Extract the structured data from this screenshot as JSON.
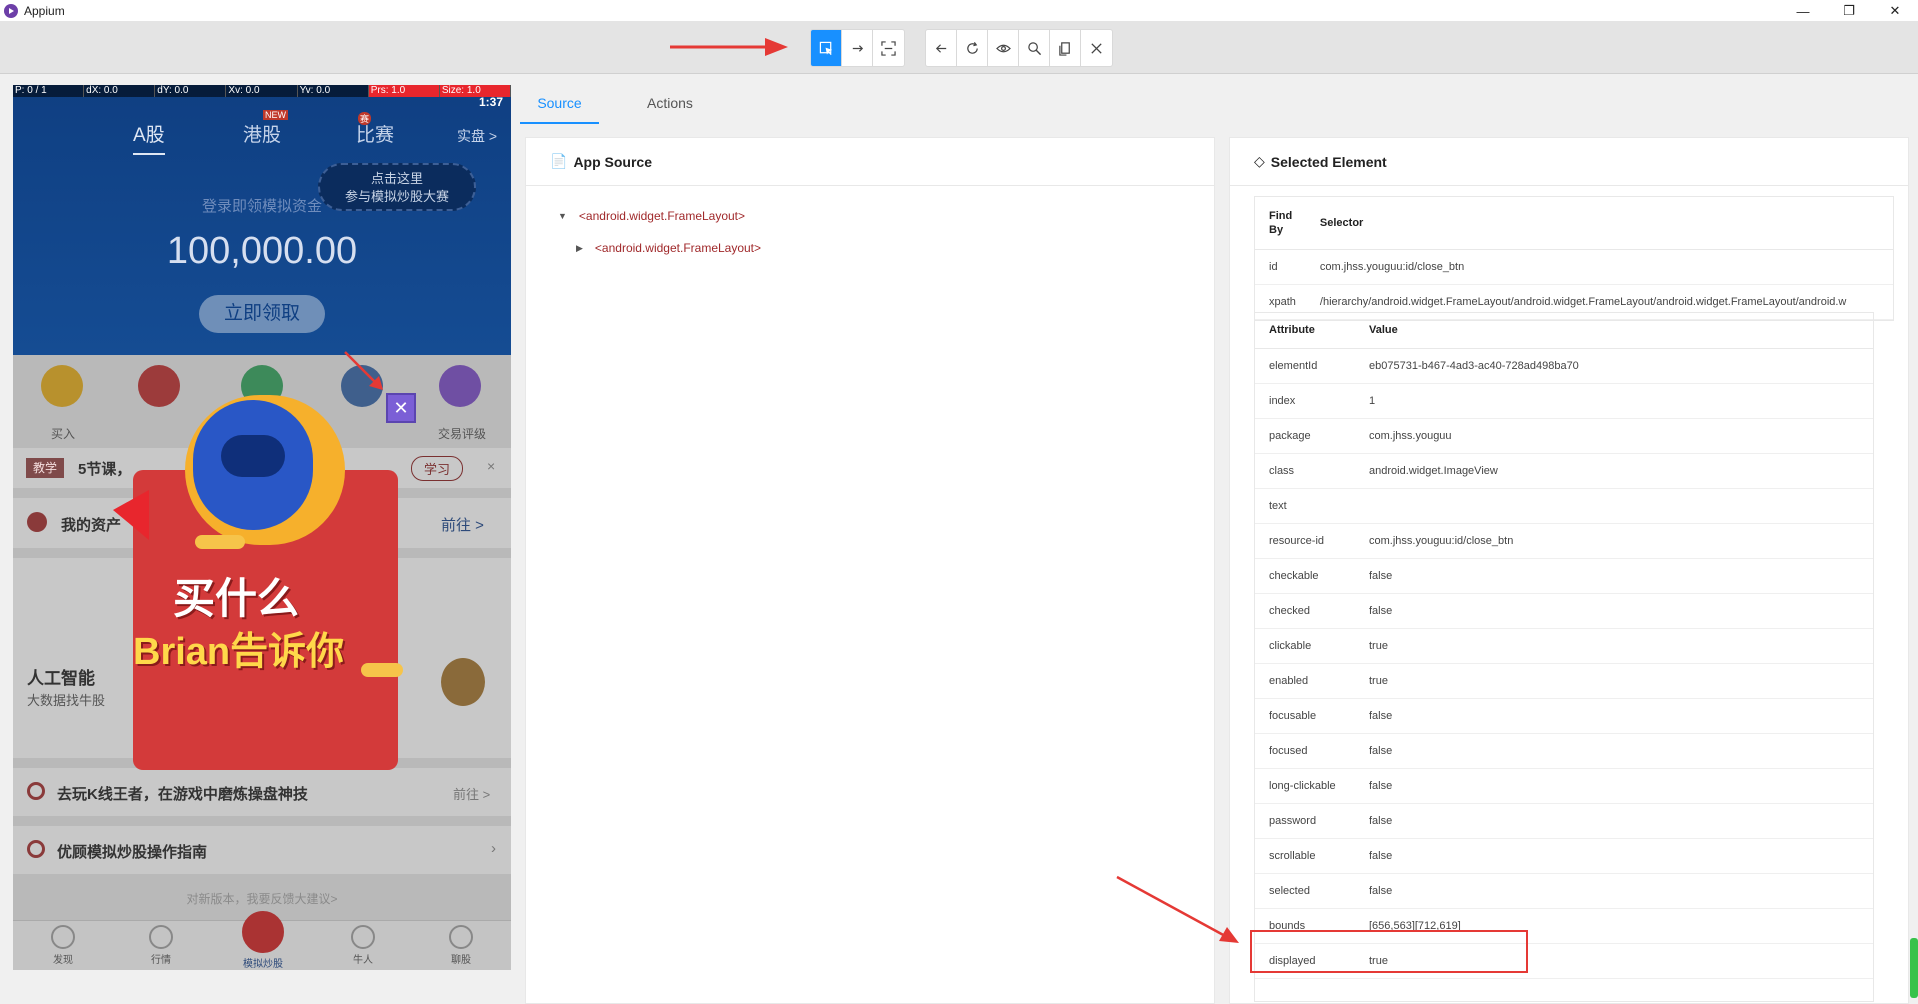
{
  "window": {
    "title": "Appium",
    "controls": [
      "—",
      "❐",
      "✕"
    ]
  },
  "toolbar": {
    "group1": [
      {
        "name": "select-elements-icon",
        "active": true
      },
      {
        "name": "swipe-icon",
        "active": false
      },
      {
        "name": "tap-by-coordinates-icon",
        "active": false
      }
    ],
    "group2": [
      {
        "name": "back-icon"
      },
      {
        "name": "refresh-icon"
      },
      {
        "name": "eye-icon"
      },
      {
        "name": "search-icon"
      },
      {
        "name": "copy-xml-icon"
      },
      {
        "name": "quit-icon"
      }
    ]
  },
  "device": {
    "pointer_bar": [
      "P: 0 / 1",
      "dX: 0.0",
      "dY: 0.0",
      "Xv: 0.0",
      "Yv: 0.0",
      "Prs: 1.0",
      "Size: 1.0"
    ],
    "status_time": "1:37",
    "tabs": [
      "A股",
      "港股",
      "比赛",
      "实盘 >"
    ],
    "tab_badge_new": "NEW",
    "tab_badge_sai": "赛",
    "bubble_line1": "点击这里",
    "bubble_line2": "参与模拟炒股大赛",
    "lead_text": "登录即领模拟资金",
    "big_amount": "100,000.00",
    "claim_button": "立即领取",
    "icon_labels": [
      "买入",
      "交易评级"
    ],
    "teach_tag": "教学",
    "teach_text": "5节课，",
    "learn_button": "学习",
    "assets_text": "我的资产",
    "goto_text": "前往 >",
    "ai_title": "人工智能",
    "ai_sub": "大数据找牛股",
    "game_text": "去玩K线王者，在游戏中磨炼操盘神技",
    "game_goto": "前往 >",
    "guide_text": "优顾模拟炒股操作指南",
    "feedback_text": "对新版本，我要反馈大建议>",
    "ad_text1": "买什么",
    "ad_text2": "Brian告诉你",
    "close_btn": "✕",
    "nav": [
      "发现",
      "行情",
      "模拟炒股",
      "牛人",
      "聊股"
    ]
  },
  "tabs": [
    {
      "label": "Source",
      "selected": true
    },
    {
      "label": "Actions",
      "selected": false
    }
  ],
  "source_panel": {
    "title": "App Source",
    "nodes": [
      "<android.widget.FrameLayout>",
      "<android.widget.FrameLayout>"
    ]
  },
  "selected_panel": {
    "title": "Selected Element",
    "selector_headers": [
      "Find By",
      "Selector"
    ],
    "selectors": [
      [
        "id",
        "com.jhss.youguu:id/close_btn"
      ],
      [
        "xpath",
        "/hierarchy/android.widget.FrameLayout/android.widget.FrameLayout/android.widget.FrameLayout/android.w"
      ]
    ],
    "attr_headers": [
      "Attribute",
      "Value"
    ],
    "attributes": [
      [
        "elementId",
        "eb075731-b467-4ad3-ac40-728ad498ba70"
      ],
      [
        "index",
        "1"
      ],
      [
        "package",
        "com.jhss.youguu"
      ],
      [
        "class",
        "android.widget.ImageView"
      ],
      [
        "text",
        ""
      ],
      [
        "resource-id",
        "com.jhss.youguu:id/close_btn"
      ],
      [
        "checkable",
        "false"
      ],
      [
        "checked",
        "false"
      ],
      [
        "clickable",
        "true"
      ],
      [
        "enabled",
        "true"
      ],
      [
        "focusable",
        "false"
      ],
      [
        "focused",
        "false"
      ],
      [
        "long-clickable",
        "false"
      ],
      [
        "password",
        "false"
      ],
      [
        "scrollable",
        "false"
      ],
      [
        "selected",
        "false"
      ],
      [
        "bounds",
        "[656,563][712,619]"
      ],
      [
        "displayed",
        "true"
      ]
    ]
  },
  "colors": {
    "accent": "#1890ff",
    "annotation": "#e53935"
  }
}
